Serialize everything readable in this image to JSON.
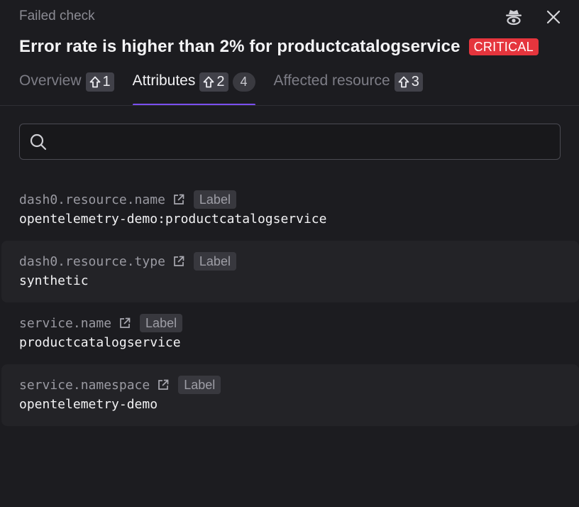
{
  "header": {
    "subtitle": "Failed check",
    "title": "Error rate is higher than 2% for productcatalogservice",
    "severity": "CRITICAL",
    "icons": [
      "spy-icon",
      "close-icon"
    ]
  },
  "tabs": [
    {
      "label": "Overview",
      "shortcut": "1",
      "active": false
    },
    {
      "label": "Attributes",
      "shortcut": "2",
      "count": "4",
      "active": true
    },
    {
      "label": "Affected resource",
      "shortcut": "3",
      "active": false
    }
  ],
  "search": {
    "value": "",
    "placeholder": ""
  },
  "attributes": [
    {
      "key": "dash0.resource.name",
      "tag": "Label",
      "value": "opentelemetry-demo:productcatalogservice"
    },
    {
      "key": "dash0.resource.type",
      "tag": "Label",
      "value": "synthetic"
    },
    {
      "key": "service.name",
      "tag": "Label",
      "value": "productcatalogservice"
    },
    {
      "key": "service.namespace",
      "tag": "Label",
      "value": "opentelemetry-demo"
    }
  ],
  "colors": {
    "accent": "#7b4ff0",
    "critical": "#e5353d",
    "background": "#1c1c20"
  }
}
